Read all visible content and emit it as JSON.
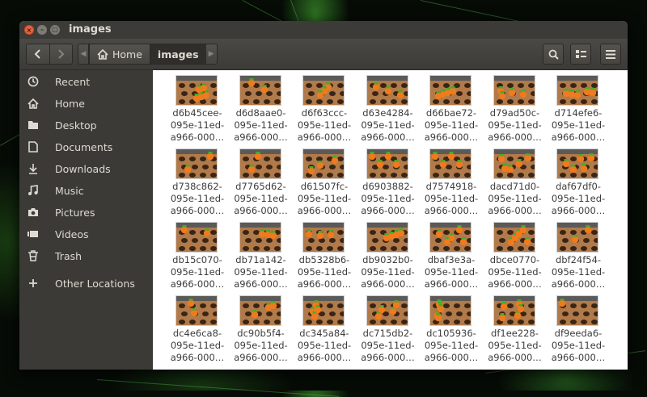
{
  "window": {
    "title": "images",
    "controls": {
      "close": "×",
      "minimize": "–",
      "maximize": "□"
    }
  },
  "toolbar": {
    "back_icon": "chevron-left-icon",
    "forward_icon": "chevron-right-icon",
    "path": [
      {
        "label": "Home",
        "icon": "home-icon"
      },
      {
        "label": "images"
      }
    ],
    "search_icon": "search-icon",
    "view_icon": "list-view-icon",
    "menu_icon": "hamburger-menu-icon"
  },
  "sidebar": {
    "items": [
      {
        "label": "Recent",
        "icon": "clock-icon"
      },
      {
        "label": "Home",
        "icon": "home-icon"
      },
      {
        "label": "Desktop",
        "icon": "folder-icon"
      },
      {
        "label": "Documents",
        "icon": "document-icon"
      },
      {
        "label": "Downloads",
        "icon": "download-icon"
      },
      {
        "label": "Music",
        "icon": "music-icon"
      },
      {
        "label": "Pictures",
        "icon": "camera-icon"
      },
      {
        "label": "Videos",
        "icon": "video-icon"
      },
      {
        "label": "Trash",
        "icon": "trash-icon"
      },
      {
        "label": "Other Locations",
        "icon": "plus-icon"
      }
    ]
  },
  "files": [
    {
      "l1": "d6b45cee-",
      "l2": "095e-11ed-",
      "l3": "a966-000…"
    },
    {
      "l1": "d6d8aae0-",
      "l2": "095e-11ed-",
      "l3": "a966-000…"
    },
    {
      "l1": "d6f63ccc-",
      "l2": "095e-11ed-",
      "l3": "a966-000…"
    },
    {
      "l1": "d63e4284-",
      "l2": "095e-11ed-",
      "l3": "a966-000…"
    },
    {
      "l1": "d66bae72-",
      "l2": "095e-11ed-",
      "l3": "a966-000…"
    },
    {
      "l1": "d79ad50c-",
      "l2": "095e-11ed-",
      "l3": "a966-000…"
    },
    {
      "l1": "d714efe6-",
      "l2": "095e-11ed-",
      "l3": "a966-000…"
    },
    {
      "l1": "d738c862-",
      "l2": "095e-11ed-",
      "l3": "a966-000…"
    },
    {
      "l1": "d7765d62-",
      "l2": "095e-11ed-",
      "l3": "a966-000…"
    },
    {
      "l1": "d61507fc-",
      "l2": "095e-11ed-",
      "l3": "a966-000…"
    },
    {
      "l1": "d6903882-",
      "l2": "095e-11ed-",
      "l3": "a966-000…"
    },
    {
      "l1": "d7574918-",
      "l2": "095e-11ed-",
      "l3": "a966-000…"
    },
    {
      "l1": "dacd71d0-",
      "l2": "095e-11ed-",
      "l3": "a966-000…"
    },
    {
      "l1": "daf67df0-",
      "l2": "095e-11ed-",
      "l3": "a966-000…"
    },
    {
      "l1": "db15c070-",
      "l2": "095e-11ed-",
      "l3": "a966-000…"
    },
    {
      "l1": "db71a142-",
      "l2": "095e-11ed-",
      "l3": "a966-000…"
    },
    {
      "l1": "db5328b6-",
      "l2": "095e-11ed-",
      "l3": "a966-000…"
    },
    {
      "l1": "db9032b0-",
      "l2": "095e-11ed-",
      "l3": "a966-000…"
    },
    {
      "l1": "dbaf3e3a-",
      "l2": "095e-11ed-",
      "l3": "a966-000…"
    },
    {
      "l1": "dbce0770-",
      "l2": "095e-11ed-",
      "l3": "a966-000…"
    },
    {
      "l1": "dbf24f54-",
      "l2": "095e-11ed-",
      "l3": "a966-000…"
    },
    {
      "l1": "dc4e6ca8-",
      "l2": "095e-11ed-",
      "l3": "a966-000…"
    },
    {
      "l1": "dc90b5f4-",
      "l2": "095e-11ed-",
      "l3": "a966-000…"
    },
    {
      "l1": "dc345a84-",
      "l2": "095e-11ed-",
      "l3": "a966-000…"
    },
    {
      "l1": "dc715db2-",
      "l2": "095e-11ed-",
      "l3": "a966-000…"
    },
    {
      "l1": "dc105936-",
      "l2": "095e-11ed-",
      "l3": "a966-000…"
    },
    {
      "l1": "df1ee228-",
      "l2": "095e-11ed-",
      "l3": "a966-000…"
    },
    {
      "l1": "df9eeda6-",
      "l2": "095e-11ed-",
      "l3": "a966-000…"
    }
  ],
  "colors": {
    "titlebar": "#3c3b37",
    "sidebar": "#3b3a36",
    "content": "#ffffff",
    "close_button": "#e9603b",
    "thumb_board": "#b07a4a",
    "thumb_item": "#f07a1c",
    "thumb_leaf": "#3fae2a"
  }
}
